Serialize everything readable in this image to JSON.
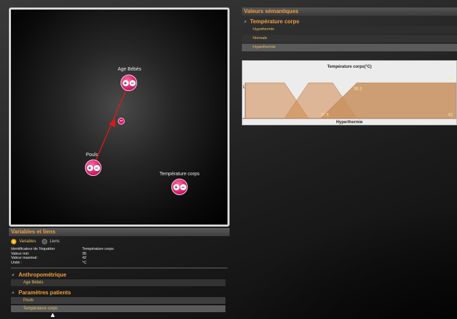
{
  "graph": {
    "nodes": [
      {
        "label": "Age Bébés",
        "plus": "+",
        "minus": "−"
      },
      {
        "label": "Pouls",
        "plus": "+",
        "minus": "−"
      },
      {
        "label": "Température corps",
        "plus": "+",
        "minus": "−"
      }
    ],
    "link_minus": "−",
    "colors": {
      "node": "#d81b6a",
      "link": "#e01818"
    }
  },
  "variables_panel": {
    "title": "Variables et liens",
    "tabs": [
      {
        "label": "Variables",
        "selected": true
      },
      {
        "label": "Liens",
        "selected": false
      }
    ],
    "properties": [
      {
        "key": "Identificateur de l'équation",
        "value": "Température corps"
      },
      {
        "key": "Valeur min",
        "value": "35"
      },
      {
        "key": "Valeur maximal :",
        "value": "42"
      },
      {
        "key": "Unité :",
        "value": "°C"
      }
    ],
    "groups": [
      {
        "title": "Anthropométrique",
        "items": [
          "Age Bébés"
        ]
      },
      {
        "title": "Paramètres patients",
        "items": [
          "Pouls",
          "Température corps"
        ]
      }
    ],
    "selected_item": "Température corps"
  },
  "semantic_panel": {
    "title": "Valeurs sémantiques",
    "group": "Température corps",
    "values": [
      "Hypothermie",
      "Normale",
      "Hyperthermie"
    ],
    "selected": "Hyperthermie"
  },
  "chart_data": {
    "type": "area",
    "title": "Température corps(°C)",
    "xlabel": "Hyperthermie",
    "ylabel": "",
    "y_tick": "1",
    "xlim": [
      35,
      42
    ],
    "ylim": [
      0,
      1
    ],
    "series": [
      {
        "name": "Hypothermie",
        "x": [
          35,
          35,
          36.3,
          37.1
        ],
        "y": [
          0,
          1,
          1,
          0
        ]
      },
      {
        "name": "Normale",
        "x": [
          36.3,
          37.1,
          37.9,
          38.7
        ],
        "y": [
          0,
          1,
          1,
          0
        ]
      },
      {
        "name": "Hyperthermie",
        "x": [
          37.5,
          38.7,
          42,
          42
        ],
        "y": [
          0,
          1,
          1,
          0
        ]
      }
    ],
    "annotations": [
      {
        "text": "36.3",
        "x": 38.6,
        "y": 0.8
      },
      {
        "text": "42",
        "x": 42,
        "y": 1.1
      },
      {
        "text": "37.5",
        "x": 37.5,
        "y": 0.07
      },
      {
        "text": "42",
        "x": 42,
        "y": 0.07
      }
    ],
    "colors": {
      "fill": "#d08a50",
      "selected_fill": "#c8905e",
      "title": "#222"
    }
  }
}
